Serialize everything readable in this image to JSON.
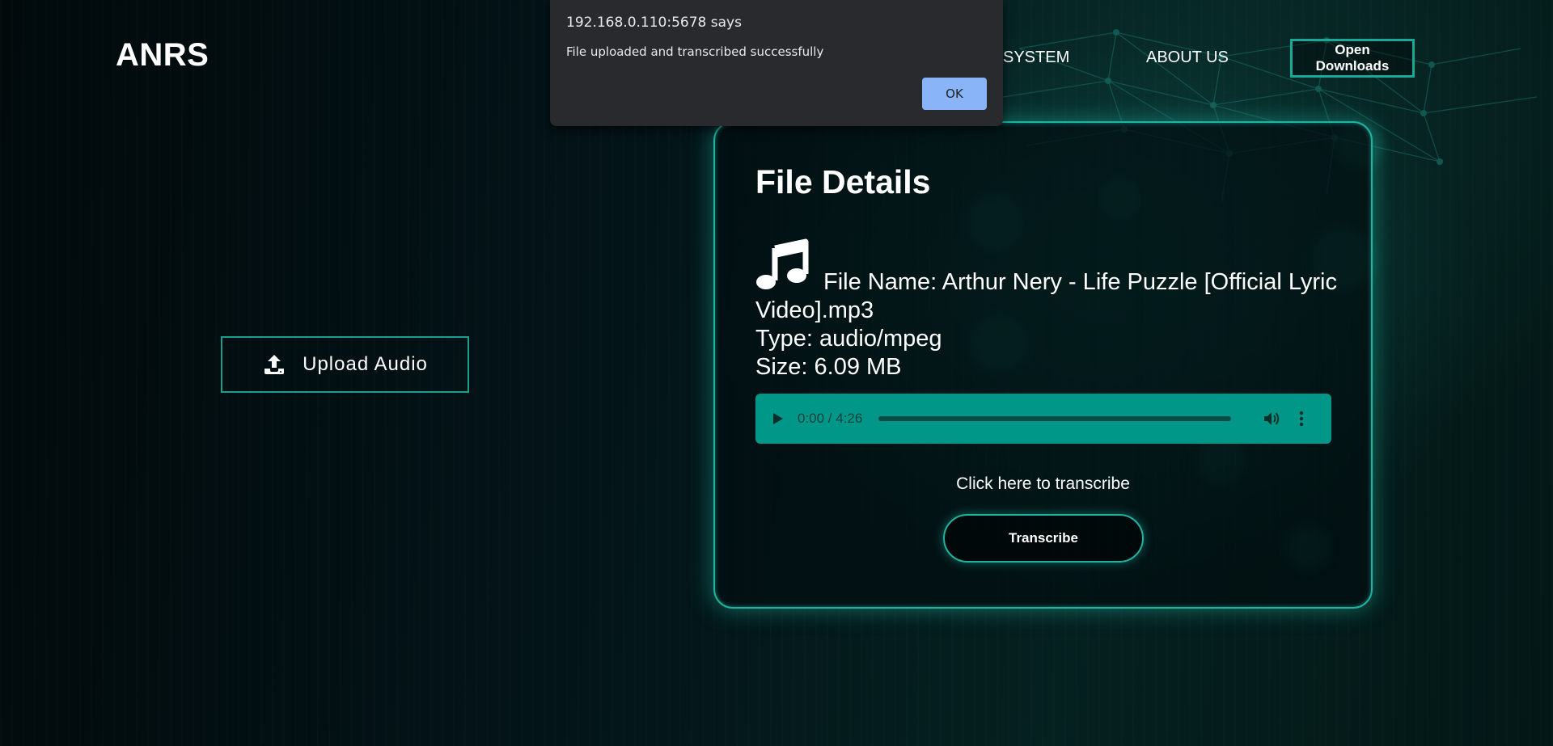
{
  "header": {
    "logo": "ANRS",
    "nav": [
      {
        "label": "SYSTEM"
      },
      {
        "label": "ABOUT US"
      }
    ],
    "open_downloads_label": "Open Downloads"
  },
  "upload": {
    "label": "Upload Audio",
    "icon": "upload-icon"
  },
  "file_details": {
    "title": "File Details",
    "icon": "music-note-icon",
    "file_name_line": "File Name: Arthur Nery - Life Puzzle [Official Lyric Video].mp3",
    "type_line": "Type: audio/mpeg",
    "size_line": "Size: 6.09 MB",
    "player": {
      "time": "0:00 / 4:26",
      "progress": 0,
      "background": "#009688"
    },
    "transcribe_hint": "Click here to transcribe",
    "transcribe_label": "Transcribe"
  },
  "dialog": {
    "origin": "192.168.0.110:5678 says",
    "message": "File uploaded and transcribed successfully",
    "ok_label": "OK"
  },
  "colors": {
    "accent": "#1fb3a1",
    "player": "#009688",
    "dialog_button": "#8ab4f8"
  }
}
